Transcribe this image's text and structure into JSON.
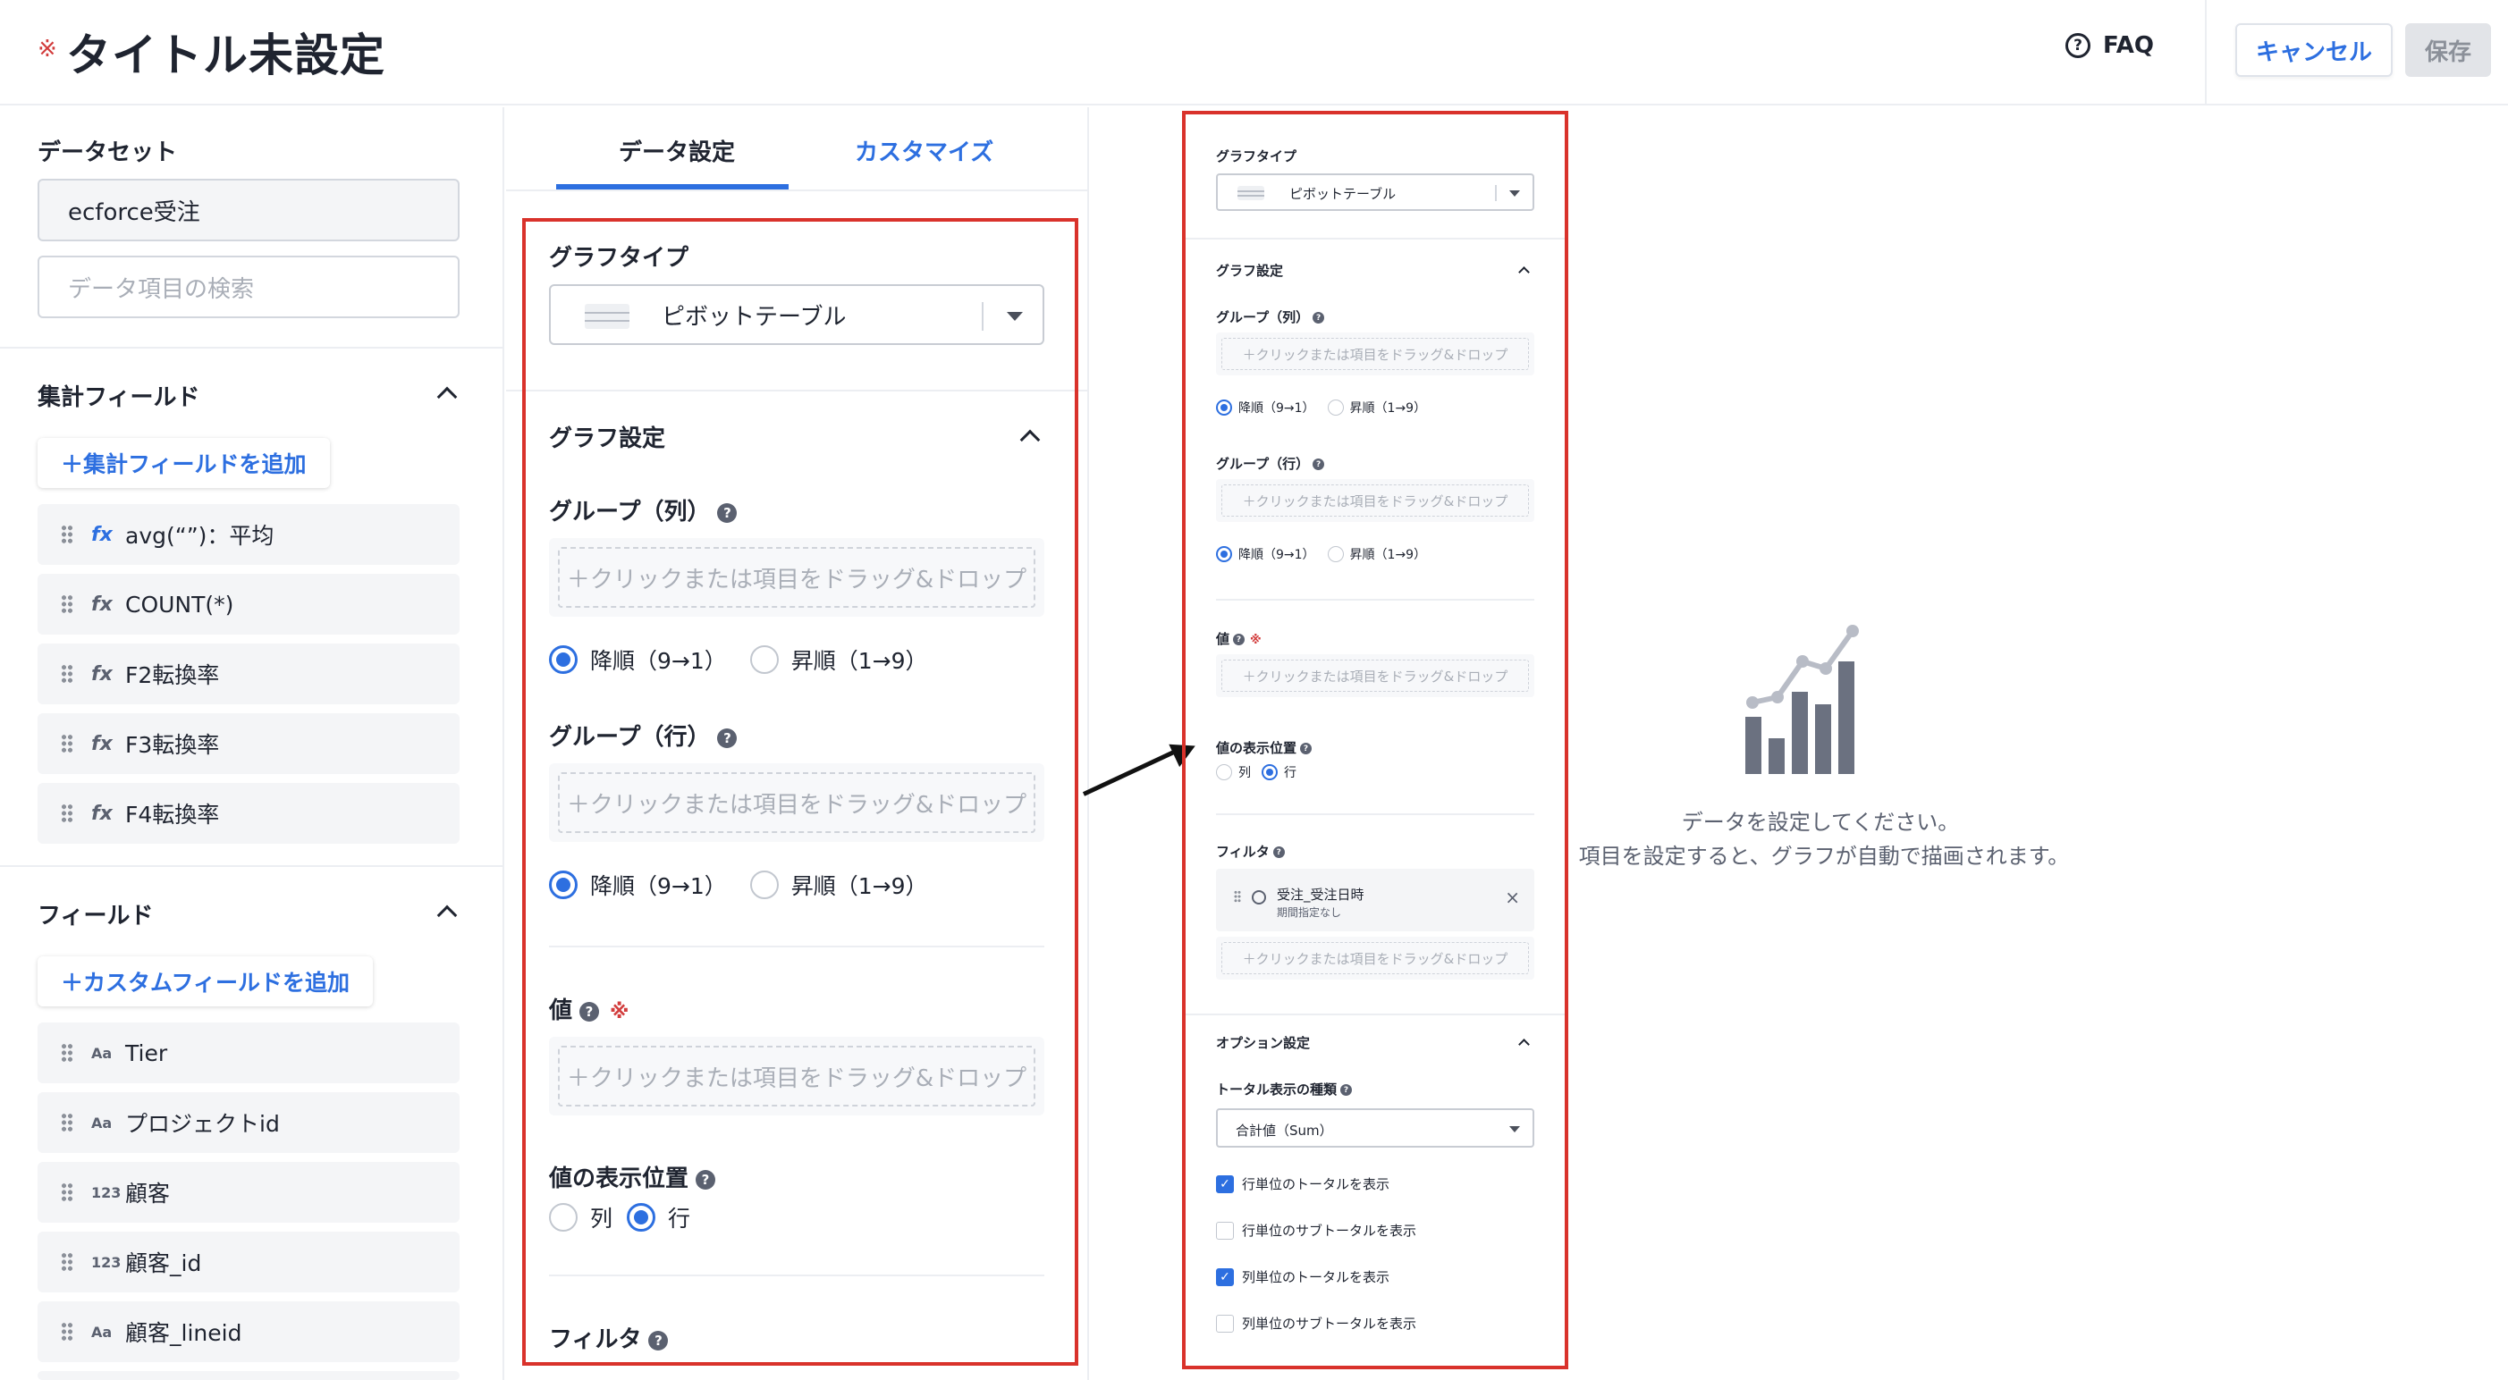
{
  "header": {
    "required_mark": "※",
    "title": "タイトル未設定",
    "faq_label": "FAQ",
    "cancel_label": "キャンセル",
    "save_label": "保存",
    "colors": {
      "accent": "#2d6fe0",
      "required": "#d23c3c"
    }
  },
  "dataset": {
    "label": "データセット",
    "value": "ecforce受注",
    "search_placeholder": "データ項目の検索"
  },
  "aggregate_fields": {
    "title": "集計フィールド",
    "add_label": "＋集計フィールドを追加",
    "items": [
      {
        "icon": "fx",
        "label": "avg(“”)：平均"
      },
      {
        "icon": "fx",
        "label": "COUNT(*)"
      },
      {
        "icon": "fx",
        "label": "F2転換率"
      },
      {
        "icon": "fx",
        "label": "F3転換率"
      },
      {
        "icon": "fx",
        "label": "F4転換率"
      }
    ]
  },
  "fields": {
    "title": "フィールド",
    "add_label": "＋カスタムフィールドを追加",
    "items": [
      {
        "icon": "Aa",
        "label": "Tier"
      },
      {
        "icon": "Aa",
        "label": "プロジェクトid"
      },
      {
        "icon": "123",
        "label": "顧客"
      },
      {
        "icon": "123",
        "label": "顧客_id"
      },
      {
        "icon": "Aa",
        "label": "顧客_lineid"
      }
    ]
  },
  "tabs": [
    {
      "label": "データ設定",
      "active": true
    },
    {
      "label": "カスタマイズ",
      "active": false
    }
  ],
  "config": {
    "graph_type_label": "グラフタイプ",
    "graph_type_value": "ピボットテーブル",
    "graph_settings_label": "グラフ設定",
    "group_col_label": "グループ（列）",
    "group_row_label": "グループ（行）",
    "drop_placeholder": "＋クリックまたは項目をドラッグ&ドロップ",
    "sort_desc": "降順（9→1）",
    "sort_asc": "昇順（1→9）",
    "value_label": "値",
    "required_mark": "※",
    "value_position_label": "値の表示位置",
    "pos_col": "列",
    "pos_row": "行",
    "filter_label": "フィルタ",
    "help_glyph": "?"
  },
  "preview": {
    "filter_item_title": "受注_受注日時",
    "filter_item_sub": "期間指定なし",
    "filter_remove": "×",
    "option_settings_label": "オプション設定",
    "total_type_label": "トータル表示の種類",
    "total_type_value": "合計値（Sum）",
    "checkboxes": [
      {
        "label": "行単位のトータルを表示",
        "checked": true
      },
      {
        "label": "行単位のサブトータルを表示",
        "checked": false
      },
      {
        "label": "列単位のトータルを表示",
        "checked": true
      },
      {
        "label": "列単位のサブトータルを表示",
        "checked": false
      }
    ],
    "check_glyph": "✓"
  },
  "empty_state": {
    "icon": "bar-line-chart-icon",
    "message": "データを設定してください。",
    "sub": "項目を設定すると、グラフが自動で描画されます。"
  }
}
